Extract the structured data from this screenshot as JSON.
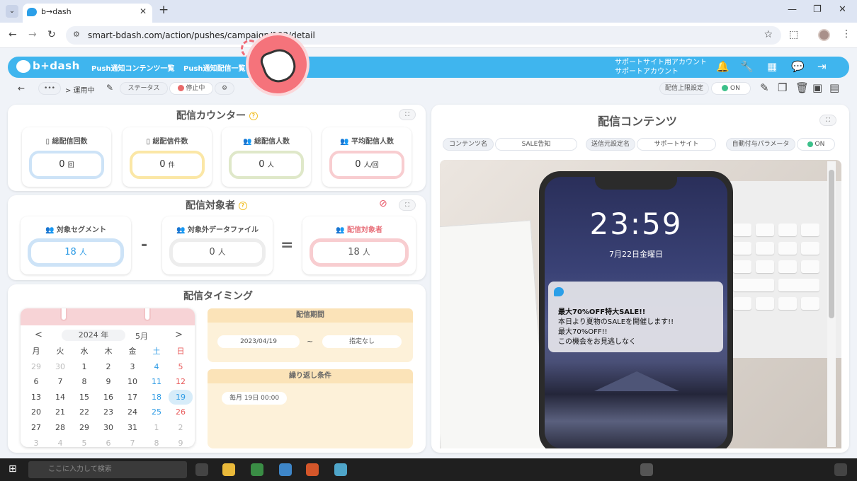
{
  "browser": {
    "tab_title": "b→dash",
    "url": "smart-bdash.com/action/pushes/campaign/183/detail"
  },
  "header": {
    "logo": "b+dash",
    "nav": [
      "Push通知コンテンツ一覧",
      "Push通知配信一覧"
    ],
    "account_line1": "サポートサイト用アカウント",
    "account_line2": "サポートアカウント"
  },
  "toolbar": {
    "dots": "•••",
    "breadcrumb": "> 運用中",
    "status_label": "ステータス",
    "status_value": "停止中",
    "limit_label": "配信上限設定",
    "limit_value": "ON"
  },
  "counter": {
    "title": "配信カウンター",
    "cards": [
      {
        "label": "総配信回数",
        "value": "0",
        "unit": "回",
        "color": "#cde3f7"
      },
      {
        "label": "総配信件数",
        "value": "0",
        "unit": "件",
        "color": "#fbe7a6"
      },
      {
        "label": "総配信人数",
        "value": "0",
        "unit": "人",
        "color": "#dfe8c9"
      },
      {
        "label": "平均配信人数",
        "value": "0",
        "unit": "人/回",
        "color": "#f8cdd0"
      }
    ]
  },
  "targets": {
    "title": "配信対象者",
    "segment_label": "対象セグメント",
    "segment_value": "18",
    "segment_unit": "人",
    "exclude_label": "対象外データファイル",
    "exclude_value": "0",
    "exclude_unit": "人",
    "result_label": "配信対象者",
    "result_value": "18",
    "result_unit": "人",
    "minus": "-",
    "equals": "="
  },
  "timing": {
    "title": "配信タイミング",
    "calendar": {
      "prev": "<",
      "next": ">",
      "year": "2024 年",
      "month": "5月",
      "weekdays": [
        "月",
        "火",
        "水",
        "木",
        "金",
        "土",
        "日"
      ],
      "rows": [
        [
          "29",
          "30",
          "1",
          "2",
          "3",
          "4",
          "5"
        ],
        [
          "6",
          "7",
          "8",
          "9",
          "10",
          "11",
          "12"
        ],
        [
          "13",
          "14",
          "15",
          "16",
          "17",
          "18",
          "19"
        ],
        [
          "20",
          "21",
          "22",
          "23",
          "24",
          "25",
          "26"
        ],
        [
          "27",
          "28",
          "29",
          "30",
          "31",
          "1",
          "2"
        ],
        [
          "3",
          "4",
          "5",
          "6",
          "7",
          "8",
          "9"
        ]
      ],
      "selected": "19"
    },
    "period_label": "配信期間",
    "period_start": "2023/04/19",
    "period_sep": "~",
    "period_end": "指定なし",
    "repeat_label": "繰り返し条件",
    "repeat_value": "毎月 19日 00:00"
  },
  "content": {
    "title": "配信コンテンツ",
    "tags": [
      {
        "label": "コンテンツ名",
        "value": "SALE告知"
      },
      {
        "label": "送信元設定名",
        "value": "サポートサイト"
      },
      {
        "label": "自動付与パラメータ",
        "value": "ON"
      }
    ],
    "phone_time": "23:59",
    "phone_date": "7月22日金曜日",
    "notif_title": "最大70%OFF特大SALE!!",
    "notif_body1": "本日より夏物のSALEを開催します!!",
    "notif_body2": "最大70%OFF!!",
    "notif_body3": "この機会をお見逃しなく"
  },
  "taskbar": {
    "search_placeholder": "ここに入力して検索"
  }
}
